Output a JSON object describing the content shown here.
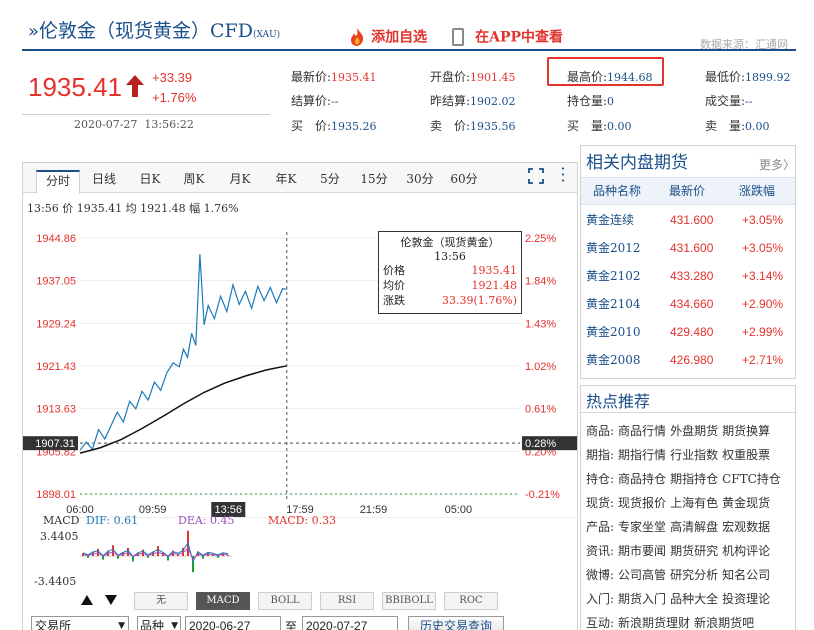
{
  "header": {
    "title": "伦敦金（现货黄金）CFD",
    "title_suffix": "(XAU)",
    "add_watch": "添加自选",
    "app_view": "在APP中查看",
    "source": "数据来源：汇通网"
  },
  "quote": {
    "price": "1935.41",
    "change": "+33.39",
    "change_pct": "+1.76%",
    "time": "2020-07-27  13:56:22"
  },
  "stats": [
    {
      "label": "最新价:",
      "value": "1935.41"
    },
    {
      "label": "开盘价:",
      "value": "1901.45"
    },
    {
      "label": "最高价:",
      "value": "1944.68"
    },
    {
      "label": "最低价:",
      "value": "1899.92"
    },
    {
      "label": "结算价:",
      "value": "--"
    },
    {
      "label": "昨结算:",
      "value": "1902.02"
    },
    {
      "label": "持仓量:",
      "value": "0"
    },
    {
      "label": "成交量:",
      "value": "--"
    },
    {
      "label": "买　价:",
      "value": "1935.26"
    },
    {
      "label": "卖　价:",
      "value": "1935.56"
    },
    {
      "label": "买　量:",
      "value": "0.00"
    },
    {
      "label": "卖　量:",
      "value": "0.00"
    }
  ],
  "chart_tabs": [
    "分时",
    "日线",
    "日K",
    "周K",
    "月K",
    "年K",
    "5分",
    "15分",
    "30分",
    "60分"
  ],
  "chart_info": "13:56 价 1935.41 均 1921.48 幅 1.76%",
  "tooltip": {
    "title": "伦敦金（现货黄金）",
    "time": "13:56",
    "rows": [
      {
        "label": "价格",
        "value": "1935.41"
      },
      {
        "label": "均价",
        "value": "1921.48"
      },
      {
        "label": "涨跌",
        "value": "33.39(1.76%)"
      }
    ]
  },
  "chart_data": {
    "type": "line",
    "title": "",
    "y_left_ticks": [
      "1944.86",
      "1937.05",
      "1929.24",
      "1921.43",
      "1913.63",
      "1905.82",
      "1898.01"
    ],
    "y_right_ticks": [
      "2.25%",
      "1.84%",
      "1.43%",
      "1.02%",
      "0.61%",
      "0.20%",
      "-0.21%"
    ],
    "x_ticks": [
      "06:00",
      "09:59",
      "13:56",
      "17:59",
      "21:59",
      "05:00"
    ],
    "ylim": [
      1898.01,
      1944.86
    ],
    "baseline": "1907.31",
    "baseline_pct": "0.28%",
    "series": [
      {
        "name": "价格",
        "color": "#1a7ab8",
        "x": [
          0,
          0.03,
          0.06,
          0.09,
          0.12,
          0.15,
          0.18,
          0.21,
          0.24,
          0.27,
          0.3,
          0.33,
          0.36,
          0.39,
          0.42,
          0.45,
          0.48,
          0.5,
          0.52,
          0.54,
          0.56,
          0.58,
          0.6,
          0.62,
          0.65,
          0.68,
          0.71,
          0.74,
          0.77,
          0.8,
          0.83,
          0.86,
          0.89,
          0.92,
          0.95,
          0.98,
          1.0
        ],
        "y": [
          1906.0,
          1907.5,
          1906.2,
          1909.8,
          1908.1,
          1910.5,
          1913.0,
          1911.2,
          1915.0,
          1913.6,
          1916.8,
          1915.2,
          1918.5,
          1917.0,
          1920.2,
          1922.0,
          1921.3,
          1924.5,
          1923.0,
          1927.4,
          1925.2,
          1941.9,
          1929.0,
          1932.5,
          1930.1,
          1934.2,
          1931.4,
          1936.3,
          1932.7,
          1935.1,
          1932.0,
          1936.0,
          1933.4,
          1935.8,
          1933.0,
          1935.6,
          1935.41
        ]
      },
      {
        "name": "均价",
        "color": "#111111",
        "x": [
          0,
          0.1,
          0.2,
          0.3,
          0.4,
          0.5,
          0.6,
          0.7,
          0.8,
          0.9,
          1.0
        ],
        "y": [
          1905.5,
          1906.5,
          1908.0,
          1910.0,
          1912.2,
          1914.5,
          1916.6,
          1918.3,
          1919.6,
          1920.7,
          1921.48
        ]
      }
    ]
  },
  "macd": {
    "label": "MACD",
    "dif": "DIF: 0.61",
    "dea": "DEA: 0.45",
    "macd": "MACD: 0.33",
    "top": "3.4405",
    "bottom": "-3.4405",
    "bars": [
      0.3,
      -0.2,
      0.5,
      0.8,
      -0.4,
      0.6,
      1.2,
      -0.3,
      0.4,
      0.9,
      -0.6,
      0.3,
      0.7,
      -0.2,
      0.5,
      1.1,
      0.4,
      -0.5,
      0.6,
      0.2,
      0.9,
      2.8,
      -1.8,
      0.5,
      -0.3,
      0.4,
      0.2,
      -0.2,
      0.3,
      0.1
    ]
  },
  "indicator_buttons": [
    "无",
    "MACD",
    "BOLL",
    "RSI",
    "BBIBOLL",
    "ROC"
  ],
  "filters": {
    "exchange": "交易所",
    "variety": "品种",
    "date_from": "2020-06-27",
    "to": "至",
    "date_to": "2020-07-27",
    "history_button": "历史交易查询"
  },
  "related": {
    "title": "相关内盘期货",
    "more": "更多",
    "headers": [
      "品种名称",
      "最新价",
      "涨跌幅"
    ],
    "rows": [
      {
        "name": "黄金连续",
        "price": "431.600",
        "pct": "+3.05%"
      },
      {
        "name": "黄金2012",
        "price": "431.600",
        "pct": "+3.05%"
      },
      {
        "name": "黄金2102",
        "price": "433.280",
        "pct": "+3.14%"
      },
      {
        "name": "黄金2104",
        "price": "434.660",
        "pct": "+2.90%"
      },
      {
        "name": "黄金2010",
        "price": "429.480",
        "pct": "+2.99%"
      },
      {
        "name": "黄金2008",
        "price": "426.980",
        "pct": "+2.71%"
      }
    ]
  },
  "hot": {
    "title": "热点推荐",
    "rows": [
      {
        "cat": "商品:",
        "links": [
          "商品行情",
          "外盘期货",
          "期货换算"
        ]
      },
      {
        "cat": "期指:",
        "links": [
          "期指行情",
          "行业指数",
          "权重股票"
        ]
      },
      {
        "cat": "持仓:",
        "links": [
          "商品持仓",
          "期指持仓",
          "CFTC持仓"
        ]
      },
      {
        "cat": "现货:",
        "links": [
          "现货报价",
          "上海有色",
          "黄金现货"
        ]
      },
      {
        "cat": "产品:",
        "links": [
          "专家坐堂",
          "高清解盘",
          "宏观数据"
        ]
      },
      {
        "cat": "资讯:",
        "links": [
          "期市要闻",
          "期货研究",
          "机构评论"
        ]
      },
      {
        "cat": "微博:",
        "links": [
          "公司高管",
          "研究分析",
          "知名公司"
        ]
      },
      {
        "cat": "入门:",
        "links": [
          "期货入门",
          "品种大全",
          "投资理论"
        ]
      },
      {
        "cat": "互动:",
        "links": [
          "新浪期货理财",
          "新浪期货吧"
        ]
      }
    ]
  }
}
